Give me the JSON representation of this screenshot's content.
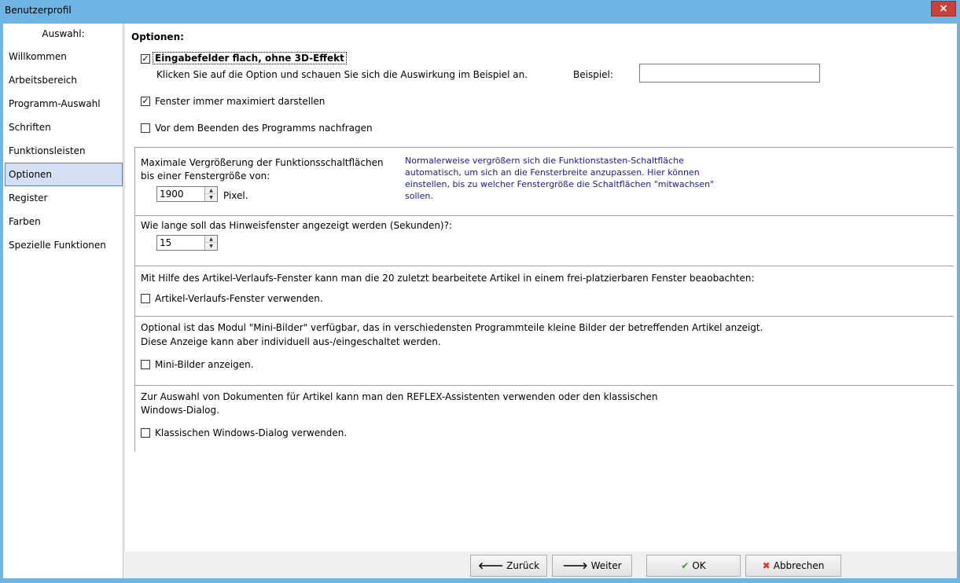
{
  "window": {
    "title": "Benutzerprofil",
    "close_label": "×"
  },
  "sidebar": {
    "header": "Auswahl:",
    "items": [
      {
        "label": "Willkommen"
      },
      {
        "label": "Arbeitsbereich"
      },
      {
        "label": "Programm-Auswahl"
      },
      {
        "label": "Schriften"
      },
      {
        "label": "Funktionsleisten"
      },
      {
        "label": "Optionen",
        "active": true
      },
      {
        "label": "Register"
      },
      {
        "label": "Farben"
      },
      {
        "label": "Spezielle Funktionen"
      }
    ]
  },
  "options": {
    "title": "Optionen:",
    "flat_fields": {
      "label": "Eingabefelder flach, ohne 3D-Effekt",
      "checked": true,
      "hint": "Klicken Sie auf die Option und schauen Sie sich die Auswirkung im Beispiel an.",
      "example_label": "Beispiel:",
      "example_value": ""
    },
    "maximized": {
      "label": "Fenster immer maximiert darstellen",
      "checked": true
    },
    "confirm_exit": {
      "label": "Vor dem Beenden des Programms nachfragen",
      "checked": false
    },
    "max_enlarge": {
      "line1": "Maximale Vergrößerung der Funktionsschaltflächen",
      "line2": "bis einer Fenstergröße von:",
      "value": "1900",
      "unit": "Pixel.",
      "info": "Normalerweise vergrößern sich die Funktionstasten-Schaltfläche automatisch, um sich an die Fensterbreite anzupassen. Hier können einstellen, bis zu welcher Fenstergröße die Schaltflächen \"mitwachsen\" sollen."
    },
    "tooltip_duration": {
      "label": "Wie lange soll das Hinweisfenster angezeigt werden (Sekunden)?:",
      "value": "15"
    },
    "history": {
      "text": "Mit Hilfe des Artikel-Verlaufs-Fenster kann man die 20 zuletzt bearbeitete Artikel in einem frei-platzierbaren Fenster beaobachten:",
      "label": "Artikel-Verlaufs-Fenster verwenden.",
      "checked": false
    },
    "mini_images": {
      "line1": "Optional ist das Modul \"Mini-Bilder\" verfügbar, das in verschiedensten Programmteile kleine Bilder der betreffenden Artikel anzeigt.",
      "line2": "Diese Anzeige kann aber individuell aus-/eingeschaltet werden.",
      "label": "Mini-Bilder anzeigen.",
      "checked": false
    },
    "documents": {
      "line1": "Zur Auswahl von Dokumenten für Artikel kann man den REFLEX-Assistenten verwenden oder den klassischen",
      "line2": "Windows-Dialog.",
      "label": "Klassischen Windows-Dialog verwenden.",
      "checked": false
    }
  },
  "footer": {
    "back": "Zurück",
    "next": "Weiter",
    "ok": "OK",
    "cancel": "Abbrechen"
  },
  "icons": {
    "back": "arrow-left-icon",
    "next": "arrow-right-icon",
    "ok": "checkmark-icon",
    "cancel": "x-icon"
  },
  "colors": {
    "accent": "#6fb5e3",
    "close": "#c7403a",
    "active_item": "#d6e0f5",
    "info_text": "#1a1a8c",
    "ok_icon": "#3a9a2a",
    "cancel_icon": "#d13a2a"
  }
}
